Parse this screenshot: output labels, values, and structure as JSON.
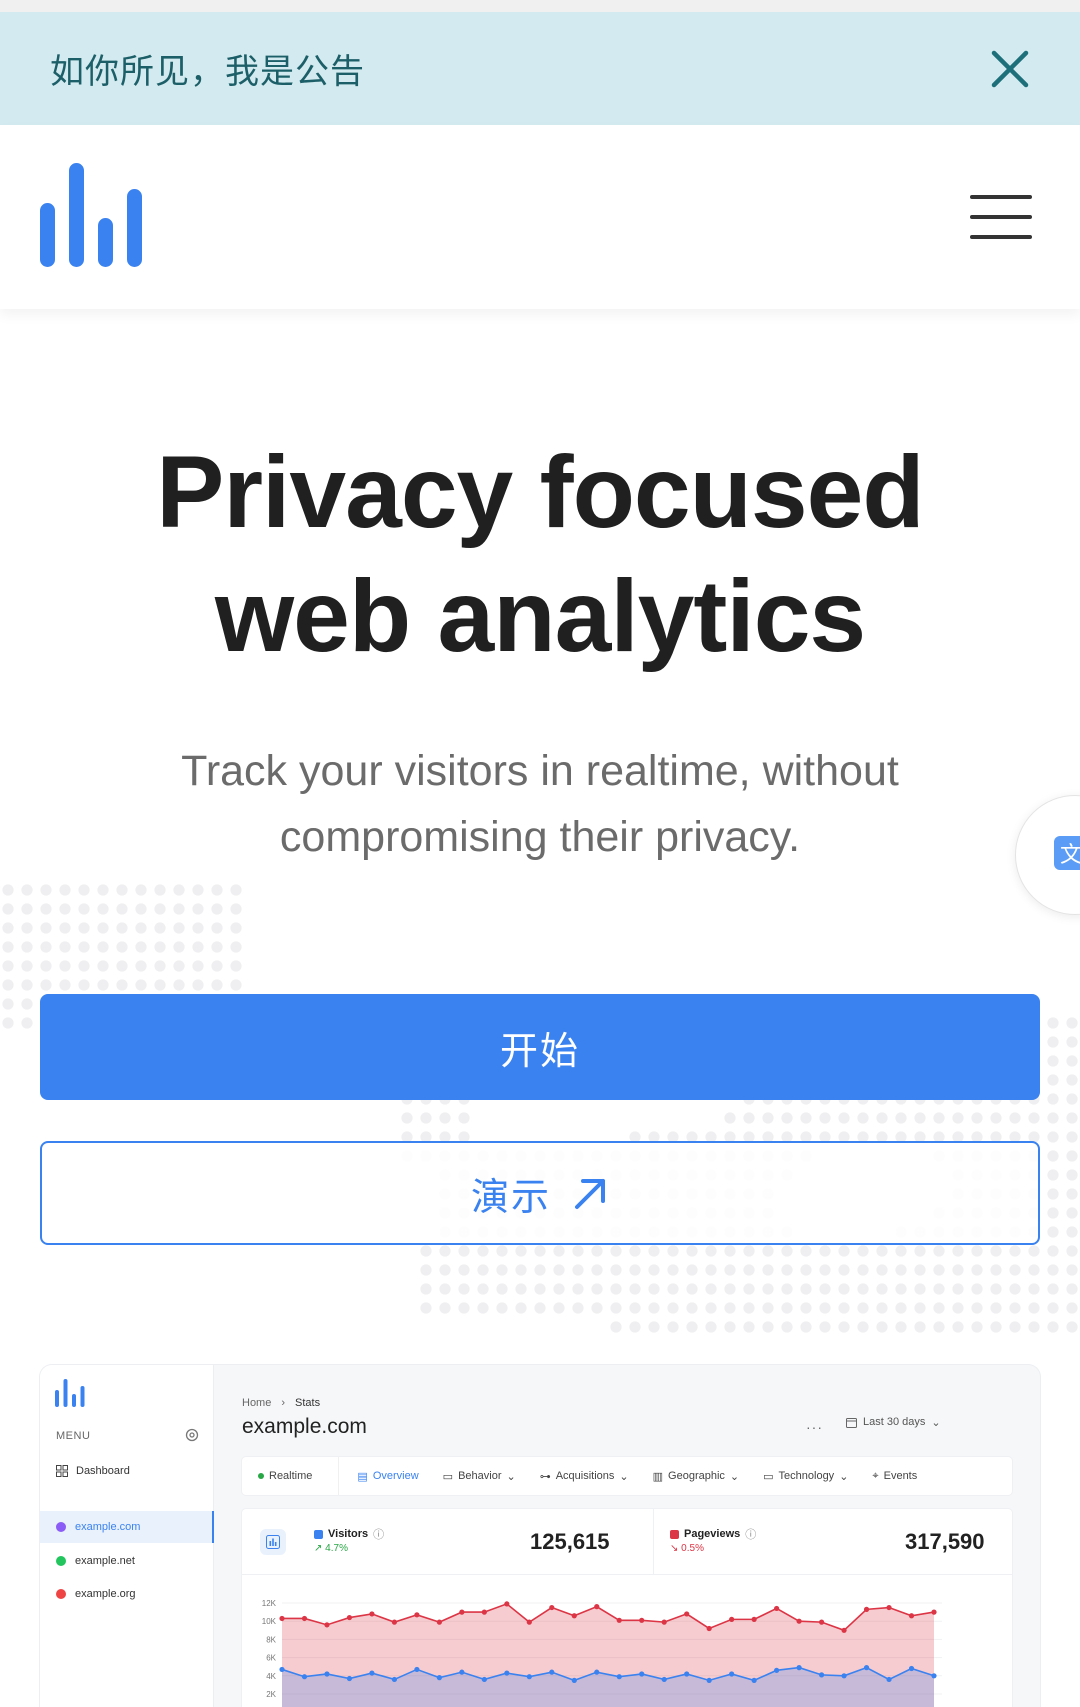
{
  "announcement": {
    "text": "如你所见，我是公告",
    "close_icon": "close-icon"
  },
  "header": {
    "logo_icon": "bar-chart-logo-icon",
    "menu_icon": "hamburger-menu-icon"
  },
  "hero": {
    "title_line1": "Privacy focused",
    "title_line2": "web analytics",
    "subtitle": "Track your visitors in realtime, without compromising their privacy."
  },
  "actions": {
    "start_label": "开始",
    "demo_label": "演示",
    "demo_icon": "arrow-up-right-icon"
  },
  "floating": {
    "translate_icon": "translate-icon",
    "glyph": "文"
  },
  "preview": {
    "menu_label": "MENU",
    "dashboard_label": "Dashboard",
    "sites": [
      {
        "name": "example.com",
        "color": "#8b5cf6",
        "active": true
      },
      {
        "name": "example.net",
        "color": "#22c55e",
        "active": false
      },
      {
        "name": "example.org",
        "color": "#ef4444",
        "active": false
      }
    ],
    "breadcrumb": [
      "Home",
      "Stats"
    ],
    "domain": "example.com",
    "more": "···",
    "range_label": "Last 30 days",
    "tabs": [
      {
        "label": "Realtime",
        "icon": "live-dot-icon"
      },
      {
        "label": "Overview",
        "icon": "chart-icon",
        "active": true
      },
      {
        "label": "Behavior",
        "icon": "table-icon",
        "dropdown": true
      },
      {
        "label": "Acquisitions",
        "icon": "branch-icon",
        "dropdown": true
      },
      {
        "label": "Geographic",
        "icon": "map-icon",
        "dropdown": true
      },
      {
        "label": "Technology",
        "icon": "device-icon",
        "dropdown": true
      },
      {
        "label": "Events",
        "icon": "target-icon"
      }
    ],
    "metrics": [
      {
        "label": "Visitors",
        "color": "#3a82f0",
        "delta": "4.7%",
        "delta_dir": "up",
        "delta_color": "#28a745",
        "value": "125,615"
      },
      {
        "label": "Pageviews",
        "color": "#dc3545",
        "delta": "0.5%",
        "delta_dir": "down",
        "delta_color": "#dc3545",
        "value": "317,590"
      }
    ]
  },
  "chart_data": {
    "type": "area",
    "y_ticks": [
      "12K",
      "10K",
      "8K",
      "6K",
      "4K",
      "2K"
    ],
    "ylim": [
      0,
      12000
    ],
    "series": [
      {
        "name": "Pageviews",
        "color": "#dc3545",
        "values": [
          10300,
          10300,
          9600,
          10400,
          10800,
          9900,
          10700,
          9900,
          11000,
          11000,
          11900,
          9900,
          11500,
          10600,
          11600,
          10100,
          10100,
          9900,
          10800,
          9200,
          10200,
          10200,
          11400,
          10000,
          9900,
          9000,
          11300,
          11500,
          10600,
          11000
        ]
      },
      {
        "name": "Visitors",
        "color": "#3a82f0",
        "values": [
          4700,
          3900,
          4200,
          3700,
          4300,
          3600,
          4700,
          3800,
          4400,
          3600,
          4300,
          3900,
          4400,
          3500,
          4400,
          3900,
          4200,
          3600,
          4200,
          3500,
          4200,
          3500,
          4600,
          4900,
          4100,
          4000,
          4900,
          3600,
          4800,
          4000
        ]
      }
    ]
  }
}
